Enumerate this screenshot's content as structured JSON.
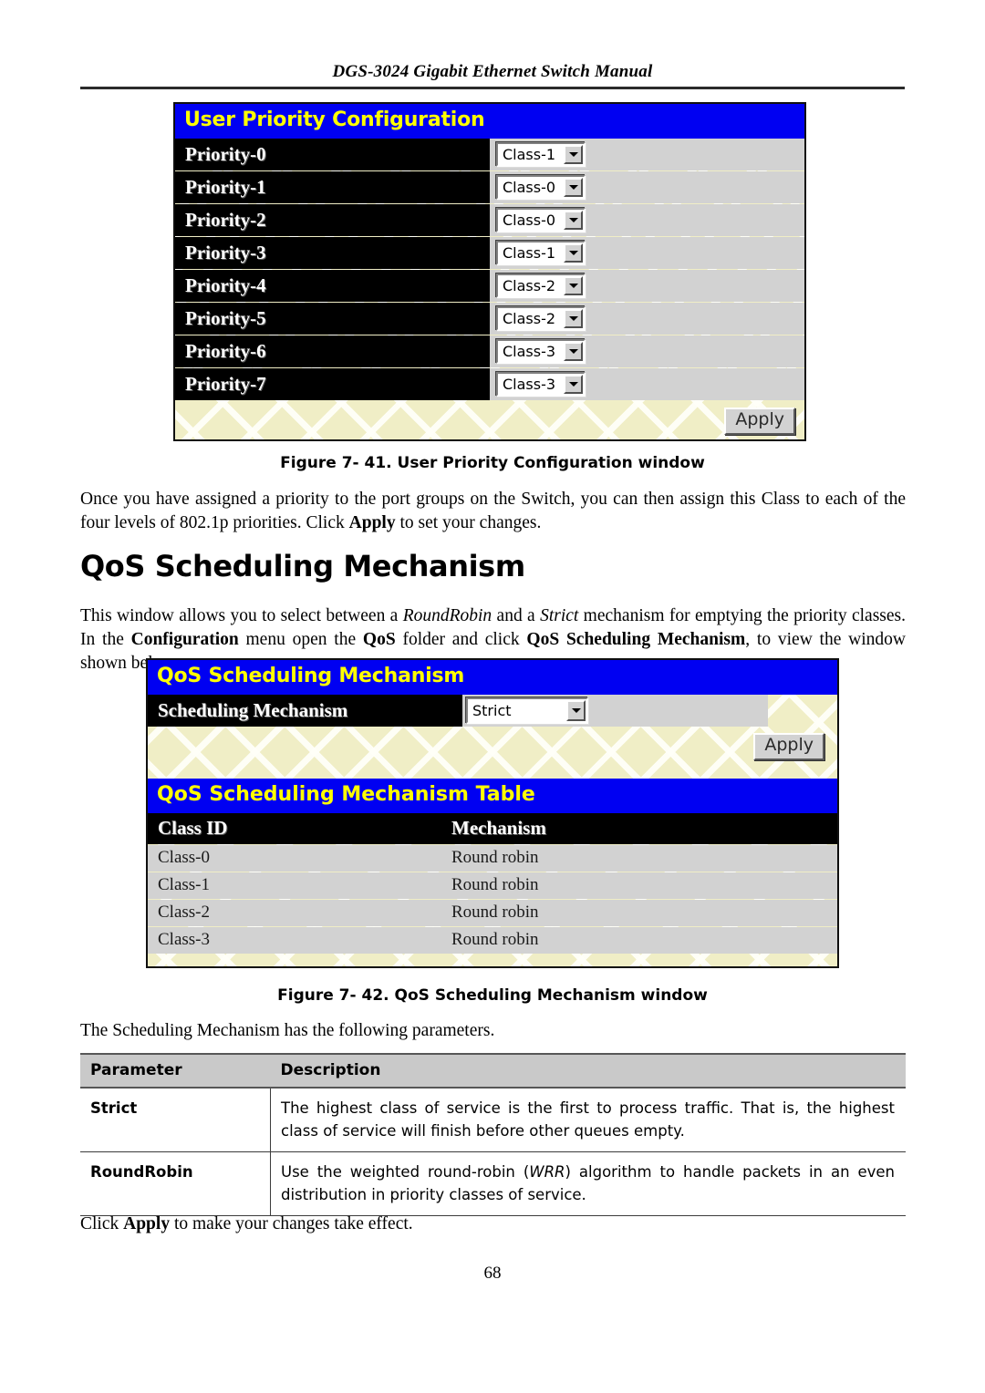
{
  "document": {
    "header_title": "DGS-3024 Gigabit Ethernet Switch Manual",
    "page_number": "68"
  },
  "user_priority_window": {
    "title": "User Priority Configuration",
    "rows": [
      {
        "label": "Priority-0",
        "value": "Class-1"
      },
      {
        "label": "Priority-1",
        "value": "Class-0"
      },
      {
        "label": "Priority-2",
        "value": "Class-0"
      },
      {
        "label": "Priority-3",
        "value": "Class-1"
      },
      {
        "label": "Priority-4",
        "value": "Class-2"
      },
      {
        "label": "Priority-5",
        "value": "Class-2"
      },
      {
        "label": "Priority-6",
        "value": "Class-3"
      },
      {
        "label": "Priority-7",
        "value": "Class-3"
      }
    ],
    "apply_label": "Apply"
  },
  "figure_41": {
    "caption": "Figure 7- 41. User Priority Configuration window"
  },
  "paragraph_after_fig41": {
    "line1": "Once you have assigned a priority to the port groups on the Switch, you can then assign this Class to each of the four levels",
    "line2_a": "of 802.1p priorities. Click ",
    "line2_bold": "Apply",
    "line2_b": " to set your changes."
  },
  "section": {
    "heading": "QoS Scheduling Mechanism"
  },
  "paragraph_intro": {
    "a": "This window allows you to select between a ",
    "italic1": "RoundRobin",
    "b": " and a ",
    "italic2": "Strict",
    "c": " mechanism for emptying the priority classes. In the ",
    "bold1": "Configuration",
    "d": " menu open the ",
    "bold2": "QoS",
    "e": " folder and click ",
    "bold3": "QoS Scheduling Mechanism",
    "f": ", to view the window shown below"
  },
  "qos_scheduling_window": {
    "title": "QoS Scheduling Mechanism",
    "field_label": "Scheduling Mechanism",
    "field_value": "Strict",
    "apply_label": "Apply",
    "table": {
      "title": "QoS Scheduling Mechanism Table",
      "columns": [
        "Class ID",
        "Mechanism"
      ],
      "rows": [
        [
          "Class-0",
          "Round robin"
        ],
        [
          "Class-1",
          "Round robin"
        ],
        [
          "Class-2",
          "Round robin"
        ],
        [
          "Class-3",
          "Round robin"
        ]
      ]
    }
  },
  "figure_42": {
    "caption": "Figure 7- 42. QoS Scheduling Mechanism window"
  },
  "paragraph_params": {
    "text": "The Scheduling Mechanism has the following parameters."
  },
  "param_table": {
    "columns": [
      "Parameter",
      "Description"
    ],
    "rows": [
      {
        "parameter": "Strict",
        "description": "The highest class of service is the first to process traffic. That is, the highest class of service will finish before other queues empty."
      },
      {
        "parameter": "RoundRobin",
        "description_a": "Use the weighted round-robin (",
        "description_italic": "WRR",
        "description_b": ") algorithm to handle packets in an even distribution in priority classes of service."
      }
    ]
  },
  "paragraph_footer": {
    "a": "Click ",
    "bold": "Apply",
    "b": " to make your changes take effect."
  },
  "colors": {
    "title_bar": "#0000f2",
    "title_text": "#ffff00",
    "label_bar": "#000000",
    "field_bg": "#d2d2d2",
    "panel_bg": "#f0eec6"
  }
}
